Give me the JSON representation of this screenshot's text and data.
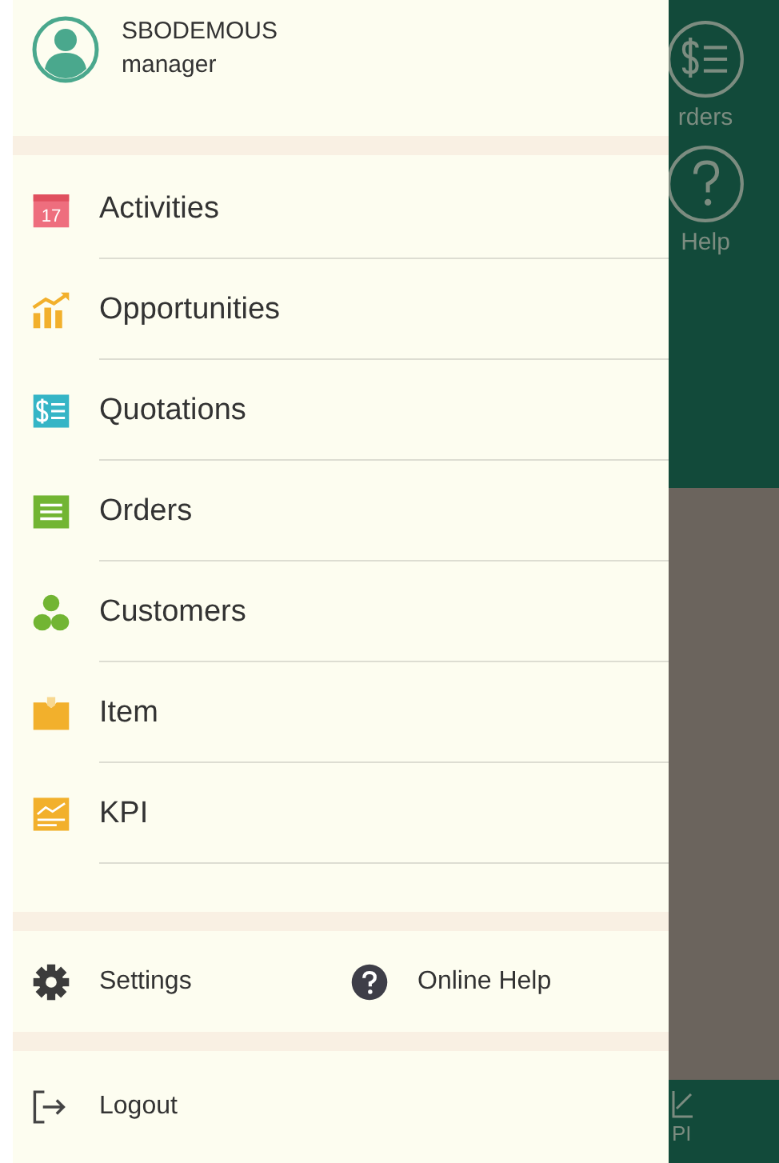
{
  "user": {
    "name": "SBODEMOUS",
    "role": "manager"
  },
  "menu": [
    {
      "kind": "calendar",
      "label": "Activities",
      "badge": "17"
    },
    {
      "kind": "chart",
      "label": "Opportunities"
    },
    {
      "kind": "quote",
      "label": "Quotations"
    },
    {
      "kind": "orders",
      "label": "Orders"
    },
    {
      "kind": "people",
      "label": "Customers"
    },
    {
      "kind": "box",
      "label": "Item"
    },
    {
      "kind": "kpi",
      "label": "KPI"
    }
  ],
  "footer": [
    {
      "kind": "gear",
      "label": "Settings"
    },
    {
      "kind": "help",
      "label": "Online Help"
    }
  ],
  "logout": {
    "label": "Logout"
  },
  "background_nav": [
    {
      "kind": "quote",
      "label": "rders"
    },
    {
      "kind": "help",
      "label": "Help"
    }
  ],
  "background_bottom": {
    "label": "PI"
  }
}
